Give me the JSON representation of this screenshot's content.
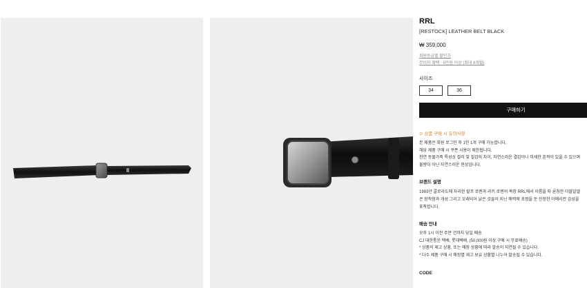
{
  "product": {
    "brand": "RRL",
    "name": "[RESTOCK] LEATHER BELT BLACK",
    "price": "₩ 359,000",
    "grade_link": "회원등급별 할인가",
    "benefit_link": "무이자 혜택 · 5만원 이상 (최대 8개월)",
    "size_label": "사이즈",
    "sizes": [
      "34",
      "36"
    ],
    "buy_label": "구매하기"
  },
  "notice": {
    "title": "⊙ 상품 구매 시 유의사항",
    "lines": [
      "본 제품은 회원 로그인 후 1인 1개 구매 가능합니다.",
      "해당 제품 구매 시 쿠폰 사용이 제한됩니다.",
      "천연 동물가죽 특성상 컬러 및 질감의 차이, 자연스러운 결감이나 미세한 흔적이 있을 수 있으며",
      "불량이 아닌 자연스러운 현상입니다."
    ]
  },
  "brand_desc": {
    "title": "브랜드 설명",
    "lines": [
      "1993년 콜로라도에 자리한 랄프 로렌과 리키 로렌의 목장 RRL에서 이름을 따 론칭한 더블알엘",
      "은 장착함과 개성 그리고 오래되어 낡은 것들이 지닌 매력에 초점을 둔 진정한 아메리칸 감성을",
      "포착합니다."
    ]
  },
  "shipping": {
    "title": "배송 안내",
    "lines": [
      "오후 1시 이전 주문 건까지 당일 배송",
      "CJ 대한통운 택배, 롯데택배, (50,000원 이상 구매 시 무료배송)",
      "* 상품의 재고 상황, 또는 매장 상황에 따라 발송이 지연될 수 있습니다.",
      "* 다수 제품 구매 시 매장별 재고 보유 상황별 나누어 발송될 수 있습니다."
    ]
  },
  "code": {
    "title": "CODE"
  },
  "images": [
    {
      "alt": "leather-belt-full"
    },
    {
      "alt": "leather-belt-buckle-closeup"
    }
  ]
}
